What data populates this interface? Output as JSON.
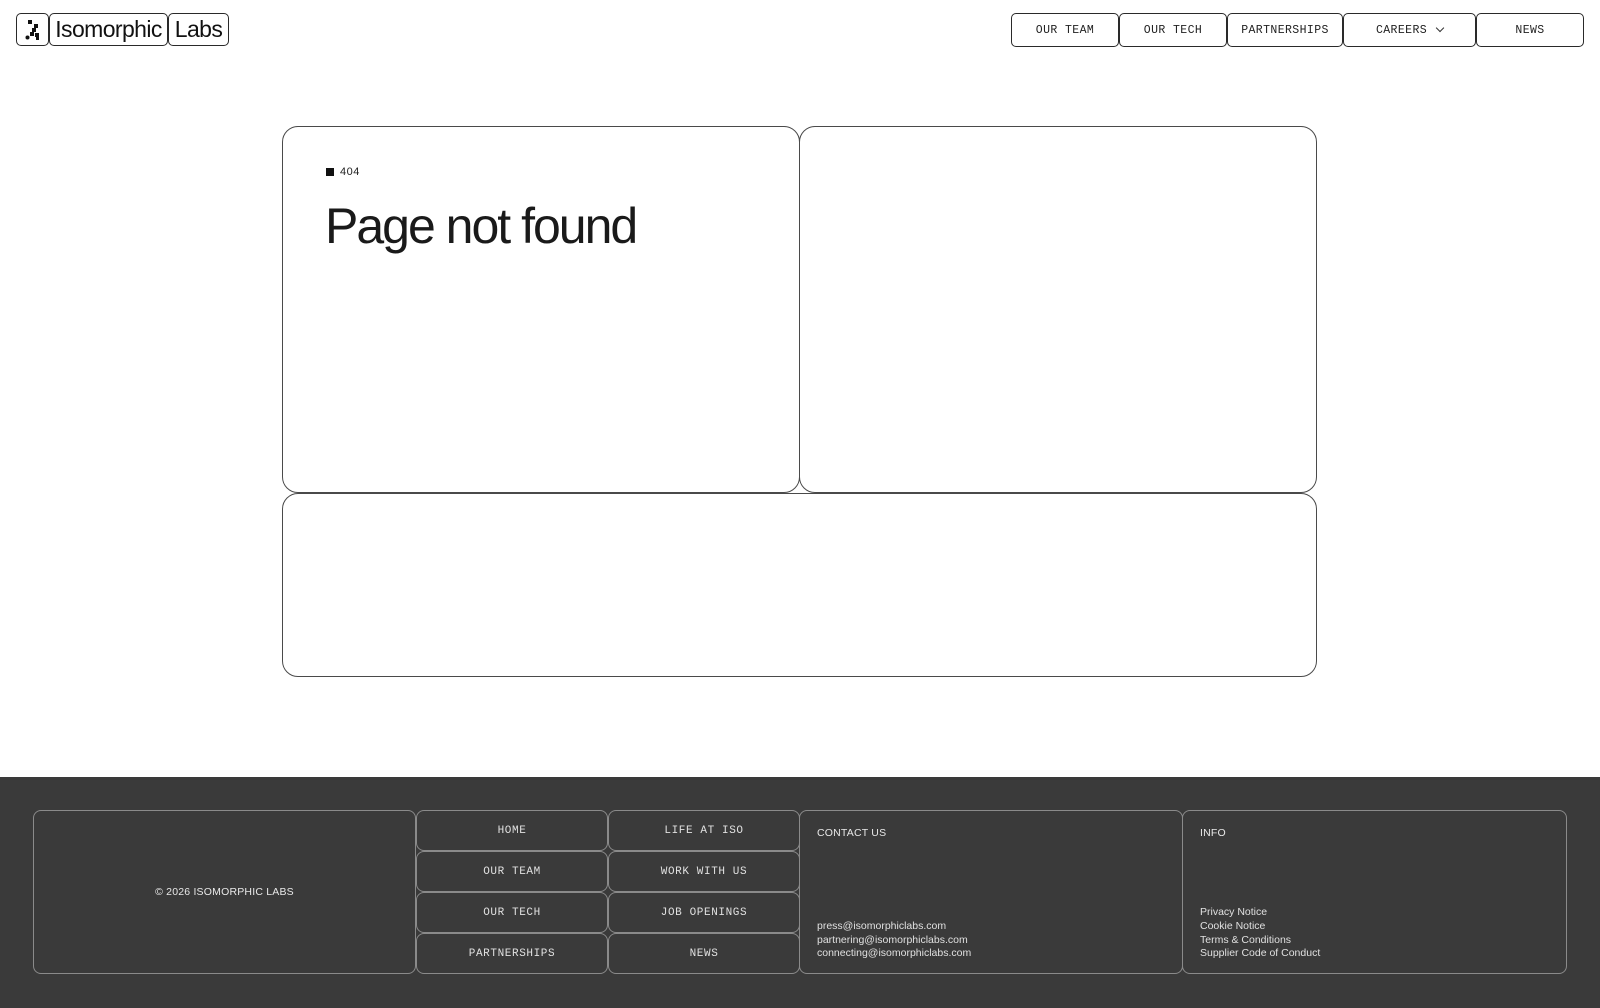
{
  "header": {
    "logo_word_1": "Isomorphic",
    "logo_word_2": "Labs",
    "logo_icon": "isomorphic-logo-icon",
    "nav": [
      {
        "label": "OUR TEAM"
      },
      {
        "label": "OUR TECH"
      },
      {
        "label": "PARTNERSHIPS"
      },
      {
        "label": "CAREERS",
        "icon": "chevron-down-icon"
      },
      {
        "label": "NEWS"
      }
    ]
  },
  "main": {
    "code": "404",
    "title": "Page not found"
  },
  "footer": {
    "copyright": "© 2026 ISOMORPHIC LABS",
    "links_col1": [
      "HOME",
      "OUR TEAM",
      "OUR TECH",
      "PARTNERSHIPS"
    ],
    "links_col2": [
      "LIFE AT ISO",
      "WORK WITH US",
      "JOB OPENINGS",
      "NEWS"
    ],
    "contact": {
      "heading": "CONTACT US",
      "emails": [
        "press@isomorphiclabs.com",
        "partnering@isomorphiclabs.com",
        "connecting@isomorphiclabs.com"
      ]
    },
    "info": {
      "heading": "INFO",
      "links": [
        "Privacy Notice",
        "Cookie Notice",
        "Terms & Conditions",
        "Supplier Code of Conduct"
      ]
    }
  },
  "colors": {
    "background": "#ffffff",
    "footer_background": "#3a3a3a",
    "border": "#2a2a2a"
  }
}
